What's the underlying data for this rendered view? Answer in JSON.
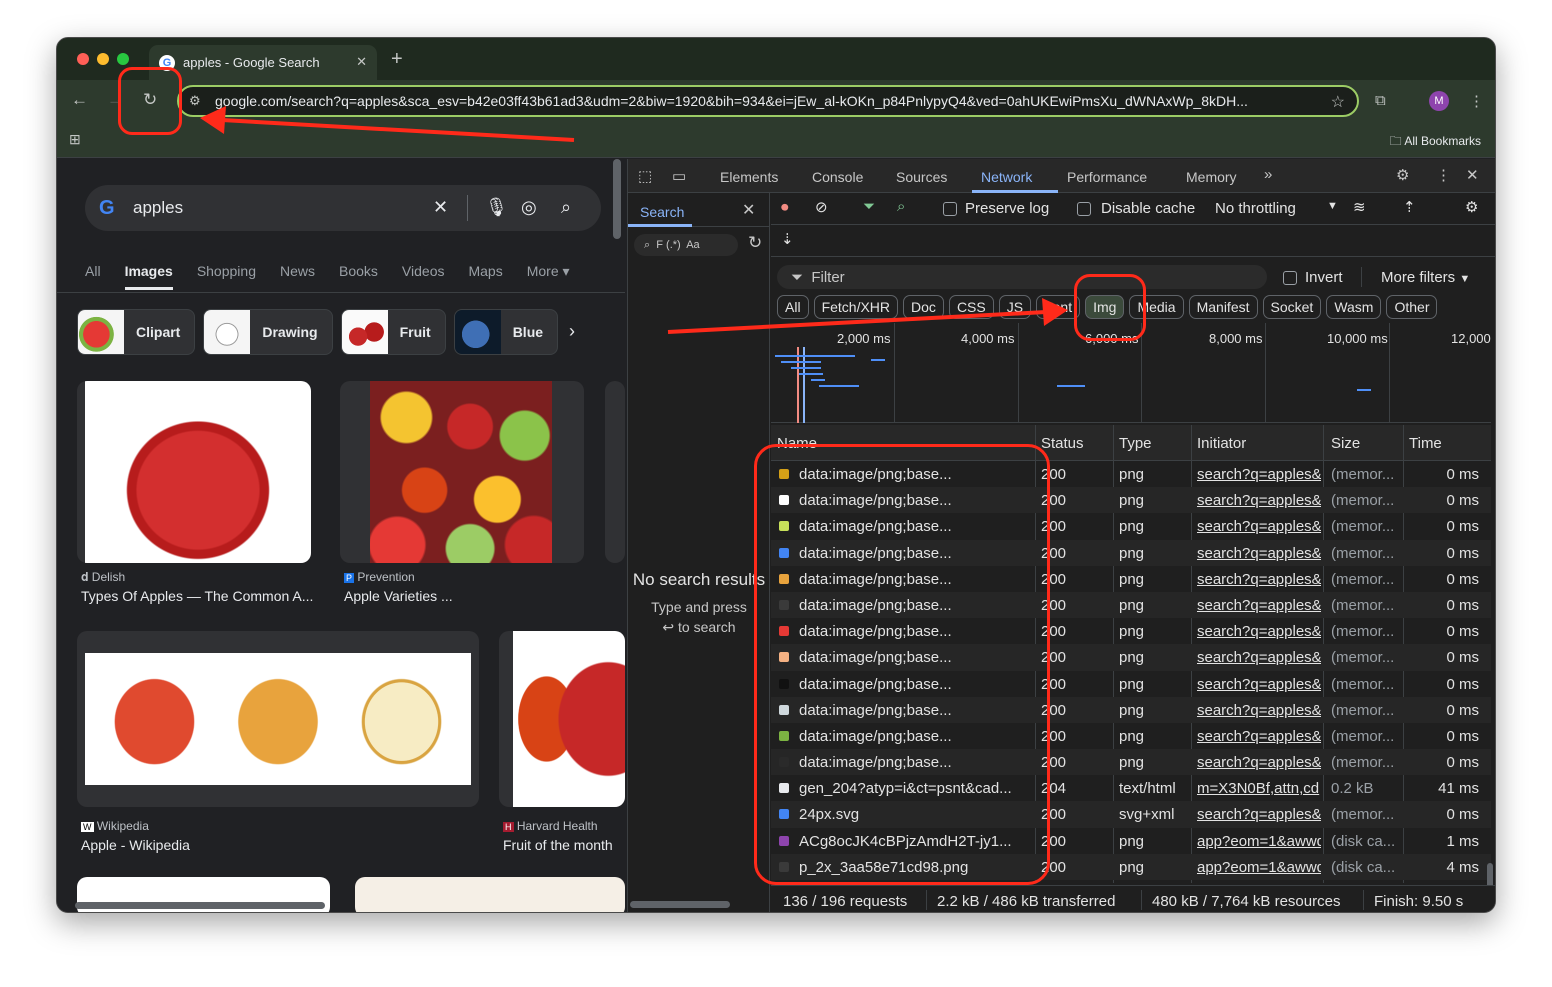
{
  "browser": {
    "tab_title": "apples - Google Search",
    "tab_close": "✕",
    "new_tab": "+",
    "url": "google.com/search?q=apples&sca_esv=b42e03ff43b61ad3&udm=2&biw=1920&bih=934&ei=jEw_al-kOKn_p84PnlypyQ4&ved=0ahUKEwiPmsXu_dWNAxWp_8kDH...",
    "avatar_letter": "M",
    "all_bookmarks": "All Bookmarks"
  },
  "google": {
    "query": "apples",
    "tabs": [
      "All",
      "Images",
      "Shopping",
      "News",
      "Books",
      "Videos",
      "Maps",
      "More ▾"
    ],
    "chips": [
      "Clipart",
      "Drawing",
      "Fruit",
      "Blue"
    ],
    "results": [
      {
        "source": "Delish",
        "title": "Types Of Apples — The Common A..."
      },
      {
        "source": "Prevention",
        "title": "Apple Varieties ..."
      },
      {
        "source": "Wikipedia",
        "title": "Apple - Wikipedia"
      },
      {
        "source": "Harvard Health",
        "title": "Fruit of the month"
      }
    ]
  },
  "devtools": {
    "tabs": [
      "Elements",
      "Console",
      "Sources",
      "Network",
      "Performance",
      "Memory"
    ],
    "active_tab": "Network",
    "search_pane": {
      "title": "Search",
      "field_hint": "F (.*)  Aa",
      "empty_title": "No search results",
      "empty_hint_1": "Type and press",
      "empty_hint_2": "↩ to search"
    },
    "network": {
      "preserve_log": "Preserve log",
      "disable_cache": "Disable cache",
      "throttling": "No throttling",
      "filter_placeholder": "Filter",
      "invert": "Invert",
      "more_filters": "More filters",
      "type_filters": [
        "All",
        "Fetch/XHR",
        "Doc",
        "CSS",
        "JS",
        "Font",
        "Img",
        "Media",
        "Manifest",
        "Socket",
        "Wasm",
        "Other"
      ],
      "active_type": "Img",
      "timeline_labels": [
        "2,000 ms",
        "4,000 ms",
        "6,000 ms",
        "8,000 ms",
        "10,000 ms",
        "12,000"
      ],
      "columns": [
        "Name",
        "Status",
        "Type",
        "Initiator",
        "Size",
        "Time"
      ],
      "rows": [
        {
          "name": "data:image/png;base...",
          "status": "200",
          "type": "png",
          "initiator": "search?q=apples&",
          "size": "(memor...",
          "time": "0 ms",
          "icon": "#d4a017"
        },
        {
          "name": "data:image/png;base...",
          "status": "200",
          "type": "png",
          "initiator": "search?q=apples&",
          "size": "(memor...",
          "time": "0 ms",
          "icon": "#ffffff"
        },
        {
          "name": "data:image/png;base...",
          "status": "200",
          "type": "png",
          "initiator": "search?q=apples&",
          "size": "(memor...",
          "time": "0 ms",
          "icon": "#c7e05a"
        },
        {
          "name": "data:image/png;base...",
          "status": "200",
          "type": "png",
          "initiator": "search?q=apples&",
          "size": "(memor...",
          "time": "0 ms",
          "icon": "#4285f4"
        },
        {
          "name": "data:image/png;base...",
          "status": "200",
          "type": "png",
          "initiator": "search?q=apples&",
          "size": "(memor...",
          "time": "0 ms",
          "icon": "#e8a33d"
        },
        {
          "name": "data:image/png;base...",
          "status": "200",
          "type": "png",
          "initiator": "search?q=apples&",
          "size": "(memor...",
          "time": "0 ms",
          "icon": "#3a3a3a"
        },
        {
          "name": "data:image/png;base...",
          "status": "200",
          "type": "png",
          "initiator": "search?q=apples&",
          "size": "(memor...",
          "time": "0 ms",
          "icon": "#e53935"
        },
        {
          "name": "data:image/png;base...",
          "status": "200",
          "type": "png",
          "initiator": "search?q=apples&",
          "size": "(memor...",
          "time": "0 ms",
          "icon": "#f4b183"
        },
        {
          "name": "data:image/png;base...",
          "status": "200",
          "type": "png",
          "initiator": "search?q=apples&",
          "size": "(memor...",
          "time": "0 ms",
          "icon": "#111111"
        },
        {
          "name": "data:image/png;base...",
          "status": "200",
          "type": "png",
          "initiator": "search?q=apples&",
          "size": "(memor...",
          "time": "0 ms",
          "icon": "#cfd8dc"
        },
        {
          "name": "data:image/png;base...",
          "status": "200",
          "type": "png",
          "initiator": "search?q=apples&",
          "size": "(memor...",
          "time": "0 ms",
          "icon": "#7cb342"
        },
        {
          "name": "data:image/png;base...",
          "status": "200",
          "type": "png",
          "initiator": "search?q=apples&",
          "size": "(memor...",
          "time": "0 ms",
          "icon": "#2a2a2a"
        },
        {
          "name": "gen_204?atyp=i&ct=psnt&cad...",
          "status": "204",
          "type": "text/html",
          "initiator": "m=X3N0Bf,attn,cd",
          "size": "0.2 kB",
          "time": "41 ms",
          "icon": "#e8eaed"
        },
        {
          "name": "24px.svg",
          "status": "200",
          "type": "svg+xml",
          "initiator": "search?q=apples&",
          "size": "(memor...",
          "time": "0 ms",
          "icon": "#4285f4"
        },
        {
          "name": "ACg8ocJK4cBPjzAmdH2T-jy1...",
          "status": "200",
          "type": "png",
          "initiator": "app?eom=1&awwd",
          "size": "(disk ca...",
          "time": "1 ms",
          "icon": "#8e44ad"
        },
        {
          "name": "p_2x_3aa58e71cd98.png",
          "status": "200",
          "type": "png",
          "initiator": "app?eom=1&awwd",
          "size": "(disk ca...",
          "time": "4 ms",
          "icon": "#3a3a3a"
        }
      ],
      "summary": {
        "requests": "136 / 196 requests",
        "transferred": "2.2 kB / 486 kB transferred",
        "resources": "480 kB / 7,764 kB resources",
        "finish": "Finish: 9.50 s"
      }
    }
  },
  "colors": {
    "annotation": "#ff2a1a",
    "accent": "#8ab4f8",
    "omnibox_border": "#9ccc65"
  }
}
